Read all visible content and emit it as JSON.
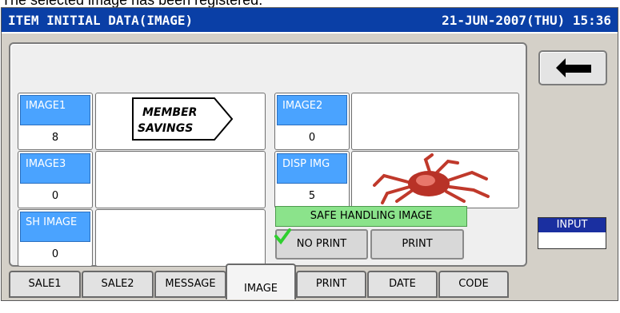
{
  "caption": "The selected image has been registered.",
  "titlebar": {
    "title": "ITEM INITIAL DATA(IMAGE)",
    "datetime": "21-JUN-2007(THU)  15:36"
  },
  "fields": {
    "image1": {
      "label": "IMAGE1",
      "value": "8"
    },
    "image2": {
      "label": "IMAGE2",
      "value": "0"
    },
    "image3": {
      "label": "IMAGE3",
      "value": "0"
    },
    "disp_img": {
      "label": "DISP IMG",
      "value": "5"
    },
    "sh_image": {
      "label": "SH IMAGE",
      "value": "0"
    }
  },
  "member_savings": {
    "line1": "MEMBER",
    "line2": "SAVINGS"
  },
  "safe_handling": {
    "label": "SAFE HANDLING IMAGE",
    "no_print": "NO PRINT",
    "print": "PRINT",
    "selected": "NO PRINT"
  },
  "side": {
    "back_icon": "back-arrow-icon",
    "input_label": "INPUT",
    "input_value": ""
  },
  "tabs": [
    {
      "label": "SALE1"
    },
    {
      "label": "SALE2"
    },
    {
      "label": "MESSAGE"
    },
    {
      "label": "IMAGE",
      "active": true
    },
    {
      "label": "PRINT"
    },
    {
      "label": "DATE"
    },
    {
      "label": "CODE"
    }
  ],
  "colors": {
    "titlebar": "#0a3fa6",
    "field_label": "#4aa3ff",
    "green_label": "#8be38b",
    "check": "#2fcf2f",
    "input_label": "#1a2fa0"
  }
}
